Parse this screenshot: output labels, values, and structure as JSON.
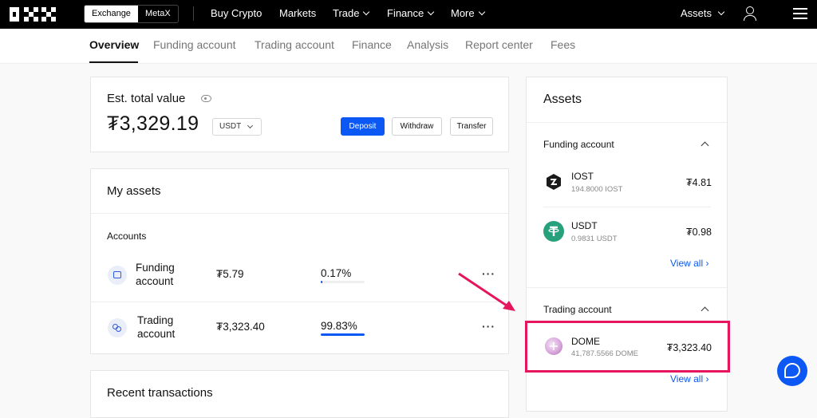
{
  "topbar": {
    "segment": [
      "Exchange",
      "MetaX"
    ],
    "nav": [
      {
        "label": "Buy Crypto"
      },
      {
        "label": "Markets"
      },
      {
        "label": "Trade"
      },
      {
        "label": "Finance"
      },
      {
        "label": "More"
      }
    ],
    "assets_label": "Assets"
  },
  "tabs": [
    "Overview",
    "Funding account",
    "Trading account",
    "Finance",
    "Analysis",
    "Report center",
    "Fees"
  ],
  "estimate": {
    "title": "Est. total value",
    "total": "₮3,329.19",
    "currency": "USDT",
    "deposit": "Deposit",
    "withdraw": "Withdraw",
    "transfer": "Transfer"
  },
  "my_assets": {
    "title": "My assets",
    "accounts_label": "Accounts",
    "accounts": [
      {
        "name": "Funding account",
        "value": "₮5.79",
        "pct": "0.17%",
        "fill": 0.0017
      },
      {
        "name": "Trading account",
        "value": "₮3,323.40",
        "pct": "99.83%",
        "fill": 0.9983
      }
    ]
  },
  "recent": {
    "title": "Recent transactions"
  },
  "assets_panel": {
    "title": "Assets",
    "funding_title": "Funding account",
    "funding": [
      {
        "name": "IOST",
        "amount": "194.8000 IOST",
        "value": "₮4.81"
      },
      {
        "name": "USDT",
        "amount": "0.9831 USDT",
        "value": "₮0.98"
      }
    ],
    "view_all": "View all ›",
    "trading_title": "Trading account",
    "trading": [
      {
        "name": "DOME",
        "amount": "41,787.5566 DOME",
        "value": "₮3,323.40"
      }
    ]
  },
  "colors": {
    "accent": "#0b58f5",
    "highlight": "#e5155e"
  }
}
